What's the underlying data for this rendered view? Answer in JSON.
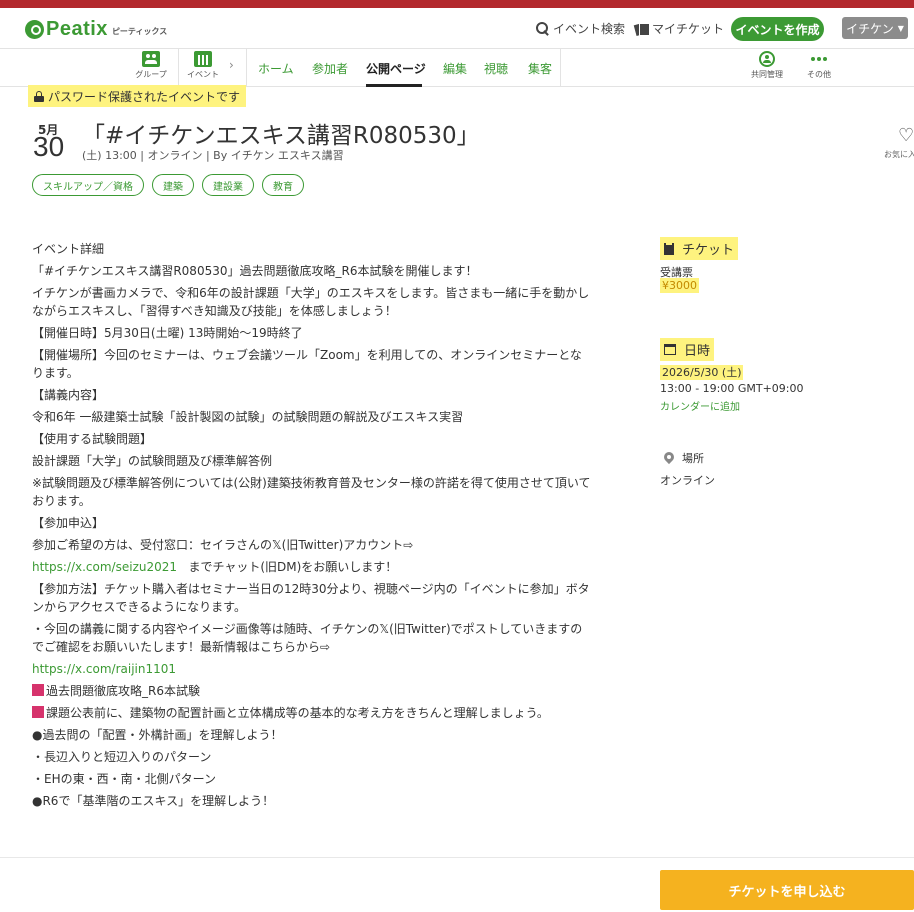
{
  "brand": {
    "name": "Peatix",
    "sub": "ピーティックス",
    "accent": "#3c9a34",
    "highlight": "#fef37f",
    "cta": "#f5b21f"
  },
  "header": {
    "search_label": "イベント検索",
    "my_tickets_label": "マイチケット",
    "create_label": "イベントを作成",
    "user_label": "イチケン"
  },
  "nav": {
    "group_label": "グループ",
    "event_label": "イベント",
    "tabs": [
      "ホーム",
      "参加者",
      "公開ページ",
      "編集",
      "視聴",
      "集客"
    ],
    "co_manage_label": "共同管理",
    "more_label": "その他"
  },
  "event": {
    "password_notice": "パスワード保護されたイベントです",
    "month": "5月",
    "day": "30",
    "title": "「#イチケンエスキス講習R080530」",
    "meta": "(土) 13:00 |  オンライン |  By イチケン エスキス講習",
    "favorite_label": "お気に入り",
    "tags": [
      "スキルアップ／資格",
      "建築",
      "建設業",
      "教育"
    ]
  },
  "description": [
    "イベント詳細",
    "「#イチケンエスキス講習R080530」過去問題徹底攻略_R6本試験を開催します！",
    "イチケンが書画カメラで、令和6年の設計課題「大学」のエスキスをします。皆さまも一緒に手を動かしながらエスキスし、「習得すべき知識及び技能」を体感しましょう！",
    "【開催日時】5月30日(土曜) 13時開始～19時終了",
    "【開催場所】今回のセミナーは、ウェブ会議ツール「Zoom」を利用しての、オンラインセミナーとなります。",
    "【講義内容】",
    "令和6年 一級建築士試験「設計製図の試験」の試験問題の解説及びエスキス実習",
    "【使用する試験問題】",
    "設計課題「大学」の試験問題及び標準解答例",
    "※試験問題及び標準解答例については(公財)建築技術教育普及センター様の許諾を得て使用させて頂いております。",
    "【参加申込】",
    "参加ご希望の方は、受付窓口：セイラさんの𝕏(旧Twitter)アカウント⇨",
    "https://x.com/seizu2021",
    "までチャット(旧DM)をお願いします！",
    "【参加方法】チケット購入者はセミナー当日の12時30分より、視聴ページ内の「イベントに参加」ボタンからアクセスできるようになります。",
    "・今回の講義に関する内容やイメージ画像等は随時、イチケンの𝕏(旧Twitter)でポストしていきますのでご確認をお願いいたします！最新情報はこちらから⇨",
    "https://x.com/raijin1101",
    "過去問題徹底攻略_R6本試験",
    "課題公表前に、建築物の配置計画と立体構成等の基本的な考え方をきちんと理解しましょう。",
    "●過去問の「配置・外構計画」を理解しよう！",
    "・長辺入りと短辺入りのパターン",
    "・EHの東・西・南・北側パターン",
    "●R6で「基準階のエスキス」を理解しよう！"
  ],
  "sidebar": {
    "ticket_heading": "チケット",
    "ticket_name": "受講票",
    "ticket_price": "¥3000",
    "date_heading": "日時",
    "date_value": "2026/5/30 (土)",
    "time_value": "13:00 - 19:00 GMT+09:00",
    "calendar_link": "カレンダーに追加",
    "place_heading": "場所",
    "place_value": "オンライン"
  },
  "cta": {
    "apply_label": "チケットを申し込む"
  }
}
